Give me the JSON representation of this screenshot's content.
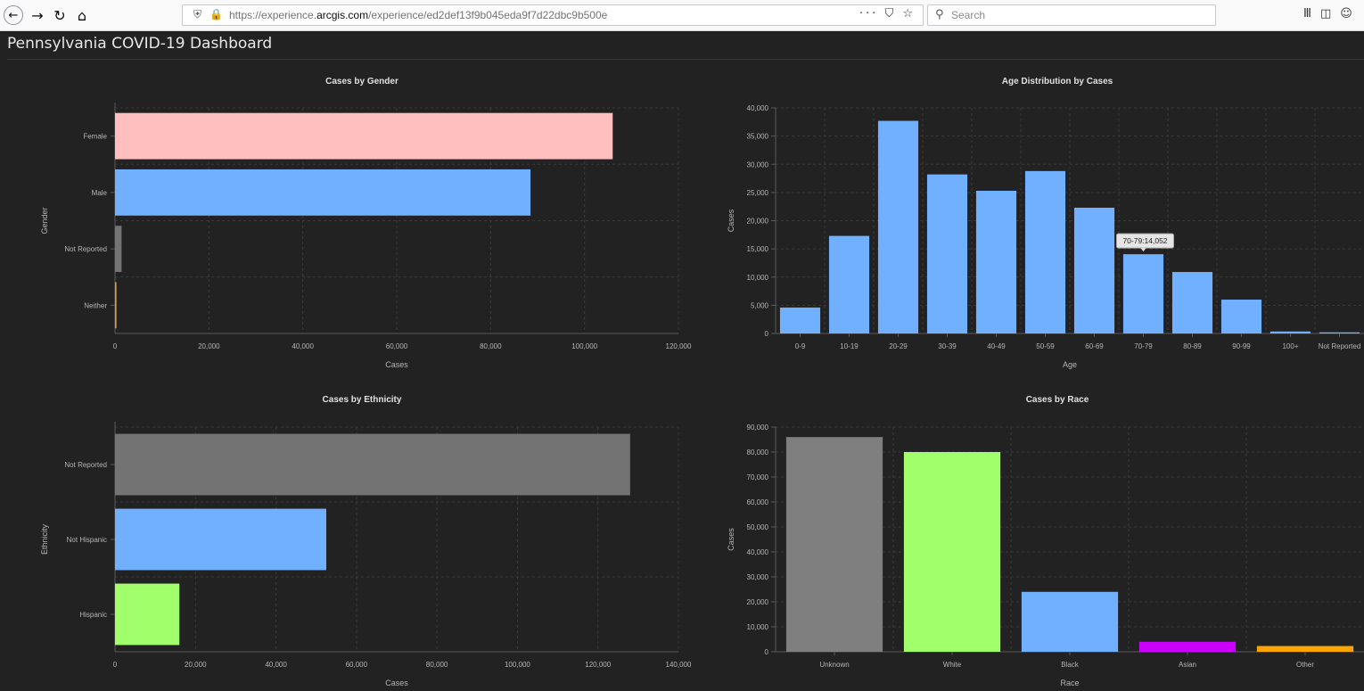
{
  "browser": {
    "url_prefix": "https://experience.",
    "url_domain": "arcgis.com",
    "url_path": "/experience/ed2def13f9b045eda9f7d22dbc9b500e",
    "page_actions": "··· ⛉ ☆",
    "search_placeholder": "Search",
    "icons": [
      "back-icon",
      "forward-icon",
      "reload-icon",
      "home-icon",
      "tracking-shield-icon",
      "lock-icon",
      "search-icon",
      "library-icon",
      "sidebar-icon",
      "account-icon"
    ]
  },
  "page": {
    "title": "Pennsylvania COVID-19 Dashboard"
  },
  "chart_data": [
    {
      "id": "gender",
      "type": "bar",
      "orientation": "horizontal",
      "title": "Cases by Gender",
      "xlabel": "Cases",
      "ylabel": "Gender",
      "categories": [
        "Female",
        "Male",
        "Not Reported",
        "Neither"
      ],
      "values": [
        106000,
        88500,
        1400,
        300
      ],
      "colors": [
        "#ffbfbf",
        "#71b0ff",
        "#737373",
        "#e6a023"
      ],
      "xlim": [
        0,
        120000
      ],
      "xticks": [
        0,
        20000,
        40000,
        60000,
        80000,
        100000,
        120000
      ],
      "grid": true
    },
    {
      "id": "age",
      "type": "bar",
      "orientation": "vertical",
      "title": "Age Distribution by Cases",
      "xlabel": "Age",
      "ylabel": "Cases",
      "categories": [
        "0-9",
        "10-19",
        "20-29",
        "30-39",
        "40-49",
        "50-59",
        "60-69",
        "70-79",
        "80-89",
        "90-99",
        "100+",
        "Not Reported"
      ],
      "values": [
        4600,
        17300,
        37700,
        28200,
        25300,
        28800,
        22300,
        14052,
        10900,
        6000,
        350,
        200
      ],
      "colors": [
        "#71b0ff"
      ],
      "ylim": [
        0,
        40000
      ],
      "yticks": [
        0,
        5000,
        10000,
        15000,
        20000,
        25000,
        30000,
        35000,
        40000
      ],
      "grid": true,
      "tooltip": {
        "category": "70-79",
        "text": "70-79:14,052"
      }
    },
    {
      "id": "ethnicity",
      "type": "bar",
      "orientation": "horizontal",
      "title": "Cases by Ethnicity",
      "xlabel": "Cases",
      "ylabel": "Ethnicity",
      "categories": [
        "Not Reported",
        "Not Hispanic",
        "Hispanic"
      ],
      "values": [
        128000,
        52500,
        16000
      ],
      "colors": [
        "#737373",
        "#71b0ff",
        "#a1ff6b"
      ],
      "xlim": [
        0,
        140000
      ],
      "xticks": [
        0,
        20000,
        40000,
        60000,
        80000,
        100000,
        120000,
        140000
      ],
      "grid": true
    },
    {
      "id": "race",
      "type": "bar",
      "orientation": "vertical",
      "title": "Cases by Race",
      "xlabel": "Race",
      "ylabel": "Cases",
      "categories": [
        "Unknown",
        "White",
        "Black",
        "Asian",
        "Other"
      ],
      "values": [
        86000,
        80000,
        24000,
        4000,
        2300
      ],
      "colors": [
        "#7f7f7f",
        "#a1ff6b",
        "#71b0ff",
        "#cc00ff",
        "#ffa500"
      ],
      "ylim": [
        0,
        90000
      ],
      "yticks": [
        0,
        10000,
        20000,
        30000,
        40000,
        50000,
        60000,
        70000,
        80000,
        90000
      ],
      "grid": true
    }
  ]
}
